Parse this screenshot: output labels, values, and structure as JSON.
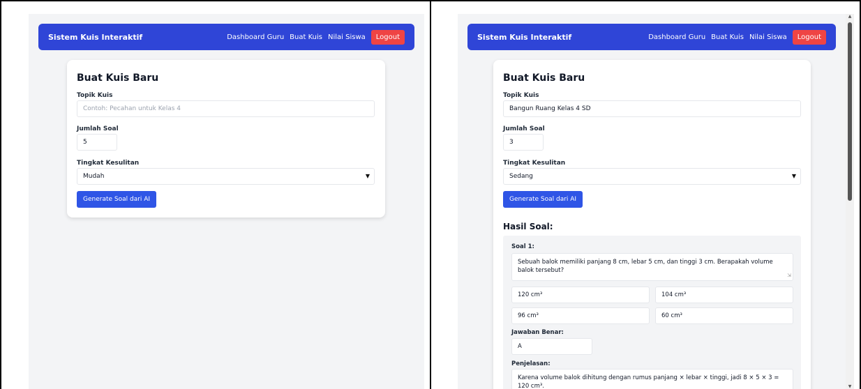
{
  "left": {
    "navbar": {
      "brand": "Sistem Kuis Interaktif",
      "links": [
        "Dashboard Guru",
        "Buat Kuis",
        "Nilai Siswa"
      ],
      "logout": "Logout"
    },
    "form": {
      "title": "Buat Kuis Baru",
      "topic_label": "Topik Kuis",
      "topic_placeholder": "Contoh: Pecahan untuk Kelas 4",
      "count_label": "Jumlah Soal",
      "count_value": "5",
      "difficulty_label": "Tingkat Kesulitan",
      "difficulty_value": "Mudah",
      "generate_label": "Generate Soal dari AI"
    }
  },
  "right": {
    "navbar": {
      "brand": "Sistem Kuis Interaktif",
      "links": [
        "Dashboard Guru",
        "Buat Kuis",
        "Nilai Siswa"
      ],
      "logout": "Logout"
    },
    "form": {
      "title": "Buat Kuis Baru",
      "topic_label": "Topik Kuis",
      "topic_value": "Bangun Ruang Kelas 4 SD",
      "count_label": "Jumlah Soal",
      "count_value": "3",
      "difficulty_label": "Tingkat Kesulitan",
      "difficulty_value": "Sedang",
      "generate_label": "Generate Soal dari AI"
    },
    "results": {
      "title": "Hasil Soal:",
      "question_label": "Soal 1:",
      "question_text": "Sebuah balok memiliki panjang 8 cm, lebar 5 cm, dan tinggi 3 cm. Berapakah volume balok tersebut?",
      "options": [
        "120 cm³",
        "104 cm³",
        "96 cm³",
        "60 cm³"
      ],
      "answer_label": "Jawaban Benar:",
      "answer_value": "A",
      "explanation_label": "Penjelasan:",
      "explanation_text": "Karena volume balok dihitung dengan rumus panjang × lebar × tinggi, jadi 8 × 5 × 3 = 120 cm³."
    }
  },
  "colors": {
    "navbar": "#2f45d7",
    "logout": "#ef4444",
    "button": "#2f55e6",
    "page_bg": "#f3f4f6"
  }
}
